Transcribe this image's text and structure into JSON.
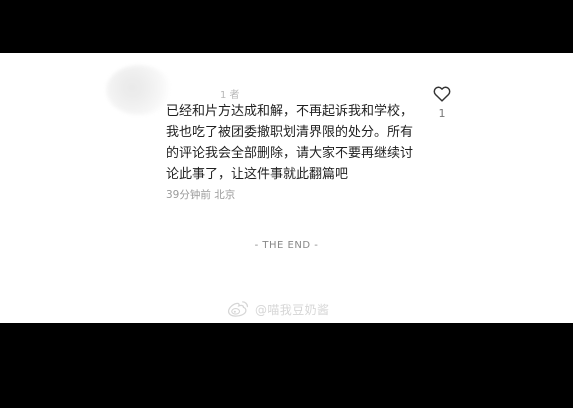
{
  "comment": {
    "author_suffix": "1 者",
    "lines": [
      "已经和片方达成和解，不再起诉我和学校，",
      "我也吃了被团委撤职划清界限的处分。所有",
      "的评论我会全部删除，请大家不要再继续讨",
      "论此事了，让这件事就此翻篇吧"
    ],
    "meta": "39分钟前 北京",
    "like_count": "1"
  },
  "footer": {
    "end_label": "- THE END -"
  },
  "watermark": {
    "text": "@喵我豆奶酱",
    "icon": "weibo-icon"
  }
}
